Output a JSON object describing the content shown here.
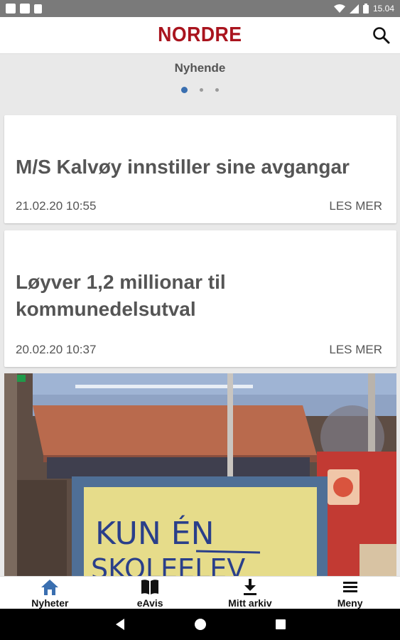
{
  "status_bar": {
    "time": "15.04",
    "icons": [
      "notification-square-icon",
      "notification-square-icon",
      "sd-card-icon",
      "wifi-icon",
      "signal-icon",
      "battery-icon"
    ]
  },
  "app_bar": {
    "title": "NORDRE",
    "brand_color": "#a9141e",
    "search_icon": "search-icon"
  },
  "section": {
    "title": "Nyhende",
    "pager_dots": 3,
    "active_dot": 1,
    "active_color": "#3a6fb0"
  },
  "articles": [
    {
      "title": "M/S Kalvøy innstiller sine avgangar",
      "date": "21.02.20 10:55",
      "more_label": "LES MER"
    },
    {
      "title": "Løyver 1,2 millionar til kommunedelsutval",
      "date": "20.02.20 10:37",
      "more_label": "LES MER"
    }
  ],
  "photo_card": {
    "sign_text_line1": "KUN ÉN",
    "sign_text_line2": "SKOLEELEV"
  },
  "bottom_nav": [
    {
      "label": "Nyheter",
      "icon": "home-icon",
      "active": true
    },
    {
      "label": "eAvis",
      "icon": "book-icon",
      "active": false
    },
    {
      "label": "Mitt arkiv",
      "icon": "download-icon",
      "active": false
    },
    {
      "label": "Meny",
      "icon": "menu-icon",
      "active": false
    }
  ],
  "system_nav": [
    "back-icon",
    "home-circle-icon",
    "recents-icon"
  ]
}
